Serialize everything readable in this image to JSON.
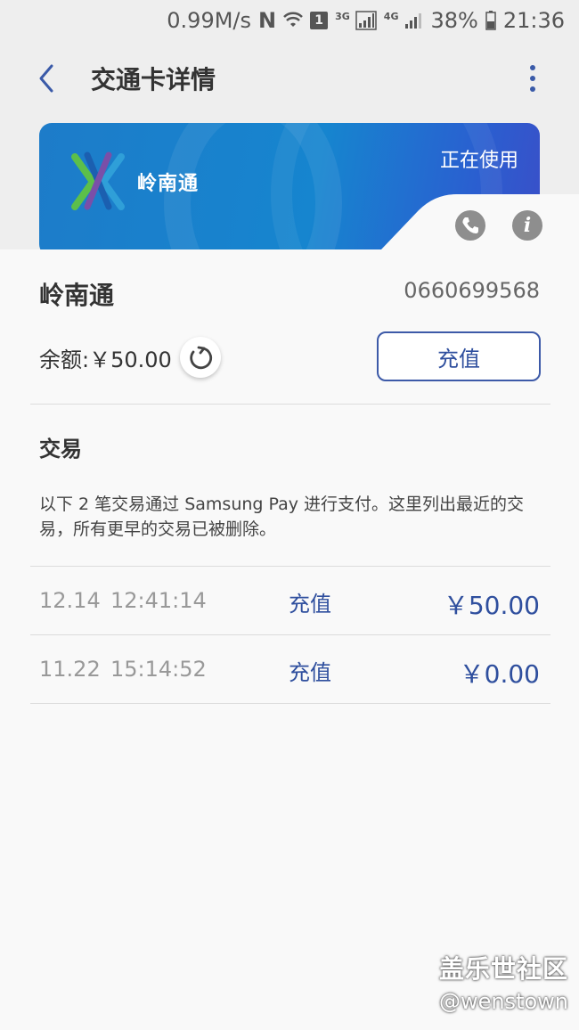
{
  "status_bar": {
    "speed": "0.99M/s",
    "nfc": "N",
    "sim_badge": "1",
    "net1": "3G",
    "net2": "4G",
    "battery": "38%",
    "time": "21:36"
  },
  "header": {
    "title": "交通卡详情"
  },
  "card": {
    "status": "正在使用",
    "brand": "岭南通",
    "logo_colors": [
      "#1b5fb0",
      "#5cbf4a",
      "#7a4fa8",
      "#2f9fd8"
    ]
  },
  "info": {
    "name": "岭南通",
    "number": "0660699568",
    "balance": "余额:￥50.00",
    "recharge_label": "充值"
  },
  "transactions": {
    "title": "交易",
    "description": "以下 2 笔交易通过 Samsung Pay 进行支付。这里列出最近的交易，所有更早的交易已被删除。",
    "items": [
      {
        "date": "12.14",
        "time": "12:41:14",
        "type": "充值",
        "amount": "￥50.00"
      },
      {
        "date": "11.22",
        "time": "15:14:52",
        "type": "充值",
        "amount": "￥0.00"
      }
    ]
  },
  "watermark": {
    "line1": "盖乐世社区",
    "line2": "@wenstown"
  },
  "colors": {
    "accent": "#2f4f9e",
    "card_blue": "#1685cf",
    "background": "#f9f9f9"
  }
}
